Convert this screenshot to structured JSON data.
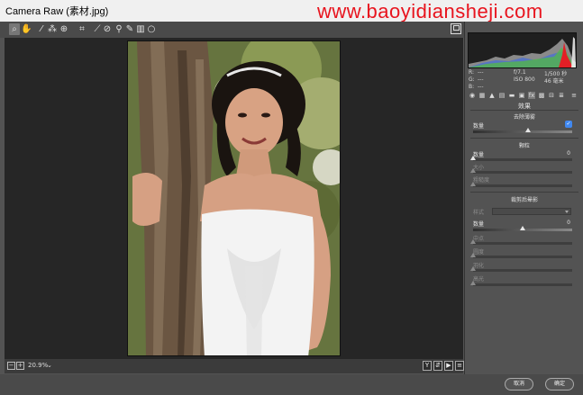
{
  "window": {
    "title": "Camera Raw (素材.jpg)",
    "watermark": "www.baoyidiansheji.com"
  },
  "toolbar": {
    "tools": [
      "zoom-icon",
      "hand-icon",
      "white-balance-icon",
      "color-sampler-icon",
      "targeted-adjustment-icon",
      "crop-icon",
      "straighten-icon",
      "spot-removal-icon",
      "red-eye-icon",
      "adjustment-brush-icon",
      "graduated-filter-icon",
      "radial-filter-icon"
    ]
  },
  "canvas": {
    "zoom_value": "20.9%"
  },
  "camera_info": {
    "r": "R:",
    "g": "G:",
    "b": "B:",
    "r_value": "---",
    "g_value": "---",
    "b_value": "---",
    "aperture": "f/7.1",
    "shutter": "1/500 秒",
    "iso": "ISO 800",
    "focal": "46 毫米"
  },
  "panel": {
    "title": "效果",
    "dehaze": {
      "title": "去除薄雾",
      "amount_label": "数量",
      "amount_value": 0.55
    },
    "grain": {
      "title": "颗粒",
      "amount_label": "数量",
      "amount_value": "0",
      "size_label": "大小",
      "roughness_label": "粗糙度"
    },
    "vignette": {
      "title": "裁剪后晕影",
      "style_label": "样式",
      "amount_label": "数量",
      "amount_value": "0",
      "midpoint_label": "中点",
      "roundness_label": "圆度",
      "feather_label": "羽化",
      "highlights_label": "高光"
    }
  },
  "footer": {
    "cancel_label": "取消",
    "ok_label": "确定"
  },
  "colors": {
    "background": "#535353",
    "canvas": "#262626",
    "accent": "#4088f0",
    "watermark": "#e8141e"
  }
}
